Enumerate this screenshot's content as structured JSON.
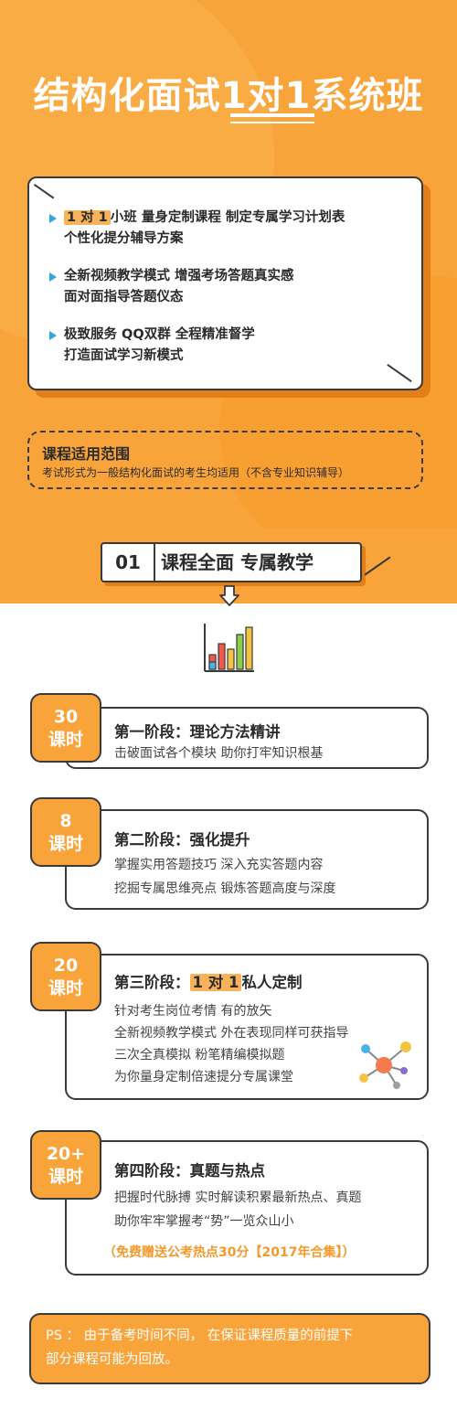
{
  "title": "结构化面试1对1系统班",
  "features": [
    {
      "highlight": "1 对 1",
      "line1_rest": "小班  量身定制课程  制定专属学习计划表",
      "line2": "个性化提分辅导方案"
    },
    {
      "highlight": "",
      "line1_rest": "全新视频教学模式  增强考场答题真实感",
      "line2": "面对面指导答题仪态"
    },
    {
      "highlight": "",
      "line1_rest": "极致服务  QQ双群  全程精准督学",
      "line2": "打造面试学习新模式"
    }
  ],
  "scope": {
    "heading": "课程适用范围",
    "text": "考试形式为一般结构化面试的考生均适用（不含专业知识辅导）"
  },
  "section": {
    "number": "01",
    "label": "课程全面 专属教学"
  },
  "stages": [
    {
      "hours": "30",
      "unit": "课时",
      "title": "第一阶段：理论方法精讲",
      "lines": [
        "击破面试各个模块  助你打牢知识根基"
      ]
    },
    {
      "hours": "8",
      "unit": "课时",
      "title": "第二阶段：强化提升",
      "lines": [
        "掌握实用答题技巧  深入充实答题内容",
        "挖掘专属思维亮点  锻炼答题高度与深度"
      ]
    },
    {
      "hours": "20",
      "unit": "课时",
      "title_prefix": "第三阶段：",
      "title_highlight": "1 对 1",
      "title_suffix": "私人定制",
      "lines": [
        "针对考生岗位考情 有的放矢",
        "全新视频教学模式 外在表现同样可获指导",
        "三次全真模拟 粉笔精编模拟题",
        "为你量身定制倍速提分专属课堂"
      ]
    },
    {
      "hours": "20+",
      "unit": "课时",
      "title": "第四阶段：真题与热点",
      "lines": [
        "把握时代脉搏 实时解读积累最新热点、真题",
        "助你牢牢掌握考“势”一览众山小"
      ],
      "gift": "（免费赠送公考热点30分【2017年合集】）"
    }
  ],
  "ps": {
    "line1": "PS ：  由于备考时间不同，  在保证课程质量的前提下",
    "line2": "部分课程可能为回放。"
  },
  "colors": {
    "orange": "#f8a43a",
    "dark_orange": "#e37f18",
    "outline": "#3a3a3a",
    "bullet_blue": "#2fa6e0",
    "gift_orange": "#f29a2c"
  }
}
